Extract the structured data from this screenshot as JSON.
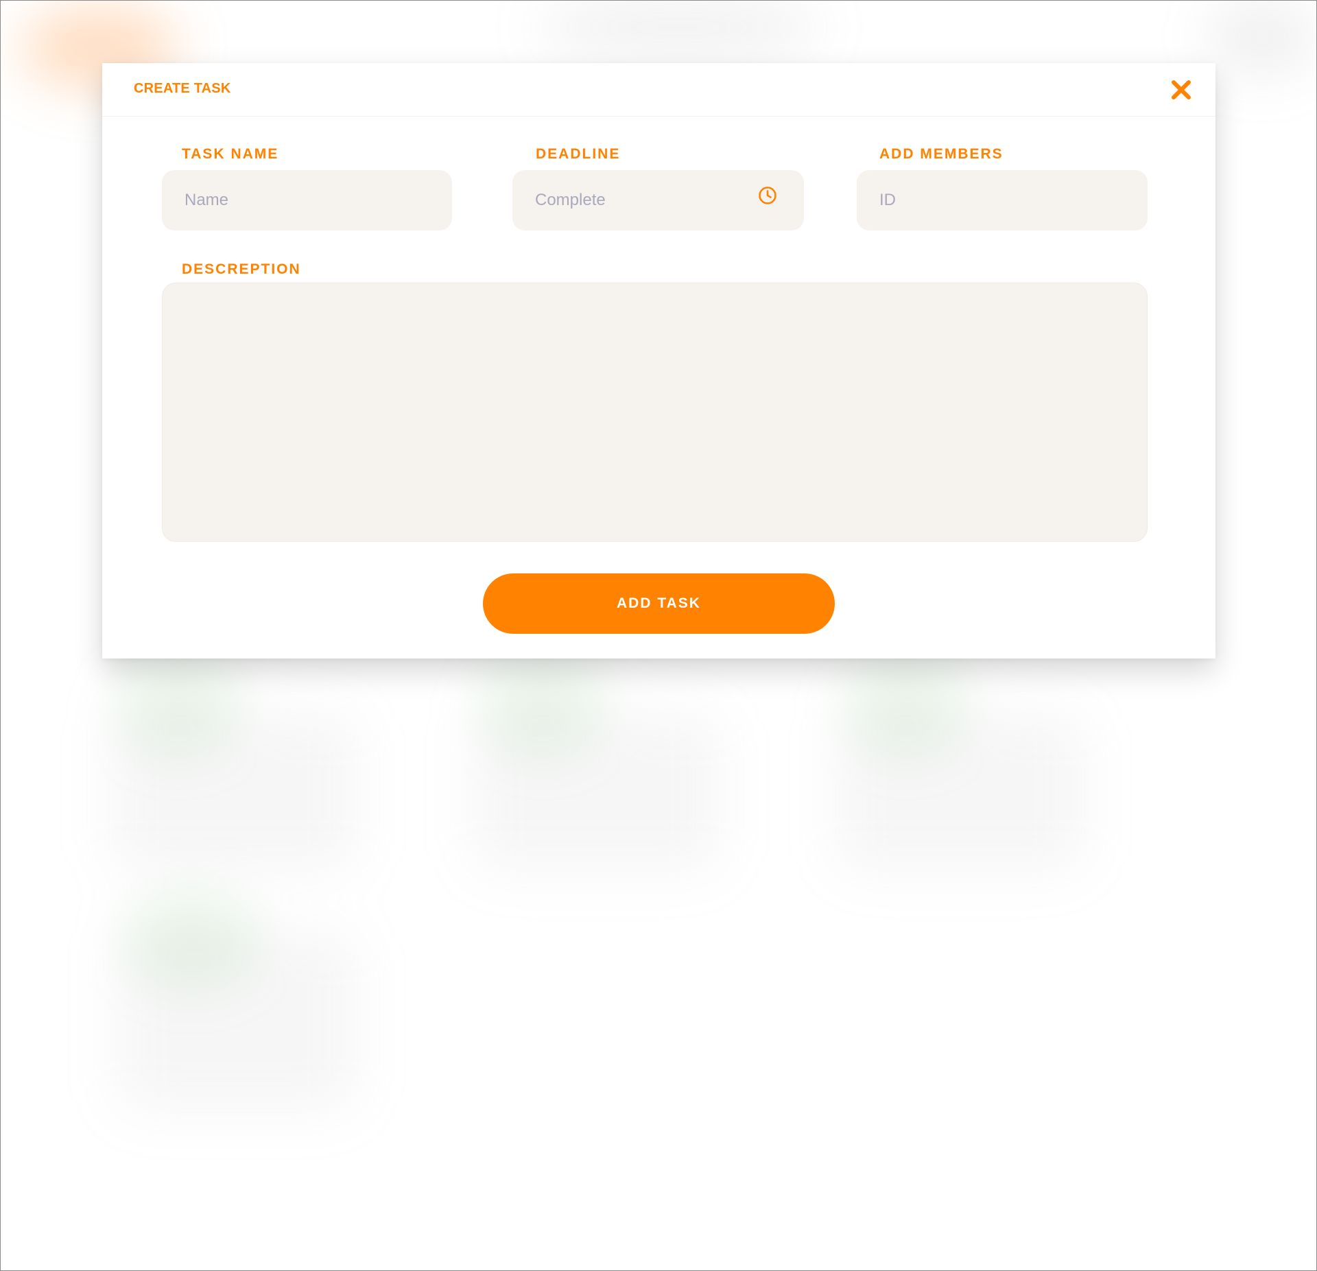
{
  "modal": {
    "title": "CREATE TASK",
    "close_icon": "close-icon"
  },
  "form": {
    "task_name": {
      "label": "TASK NAME",
      "placeholder": "Name",
      "value": ""
    },
    "deadline": {
      "label": "DEADLINE",
      "placeholder": "Complete",
      "value": "",
      "icon": "clock-icon"
    },
    "members": {
      "label": "ADD MEMBERS",
      "placeholder": "ID",
      "value": ""
    },
    "description": {
      "label": "DESCREPTION",
      "value": ""
    },
    "submit_label": "ADD TASK"
  },
  "colors": {
    "accent": "#ff8200",
    "input_bg": "#f6f3ef",
    "placeholder": "#a9a9bb"
  }
}
